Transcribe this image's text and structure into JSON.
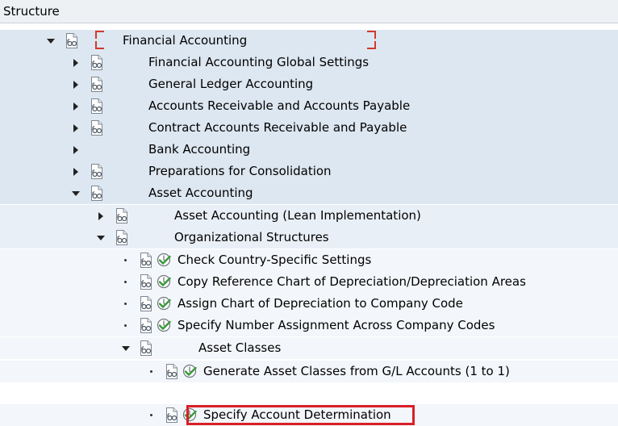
{
  "structure": {
    "header": "Structure"
  },
  "tree": {
    "financial_accounting": "Financial Accounting",
    "fa_global_settings": "Financial Accounting Global Settings",
    "general_ledger": "General Ledger Accounting",
    "ar_ap": "Accounts Receivable and Accounts Payable",
    "contract_ar_ap": "Contract Accounts Receivable and Payable",
    "bank_accounting": "Bank Accounting",
    "preparations_consolidation": "Preparations for Consolidation",
    "asset_accounting": "Asset Accounting",
    "asset_lean": "Asset Accounting (Lean Implementation)",
    "org_structures": "Organizational Structures",
    "check_country": "Check Country-Specific Settings",
    "copy_reference_chart": "Copy Reference Chart of Depreciation/Depreciation Areas",
    "assign_chart": "Assign Chart of Depreciation to Company Code",
    "specify_number_assignment": "Specify Number Assignment Across Company Codes",
    "asset_classes": "Asset Classes",
    "generate_asset_classes": "Generate Asset Classes from G/L Accounts (1 to 1)",
    "specify_account_determination": "Specify Account Determination"
  },
  "colors": {
    "selection_bracket": "#d23a2c",
    "highlight_box": "#d91f26",
    "execute_icon": "#3a9a3a"
  },
  "icons": {
    "expanded": "triangle-down-icon",
    "collapsed": "triangle-right-icon",
    "leaf": "bullet-icon",
    "doc": "documentation-glasses-icon",
    "execute": "execute-clock-icon"
  }
}
